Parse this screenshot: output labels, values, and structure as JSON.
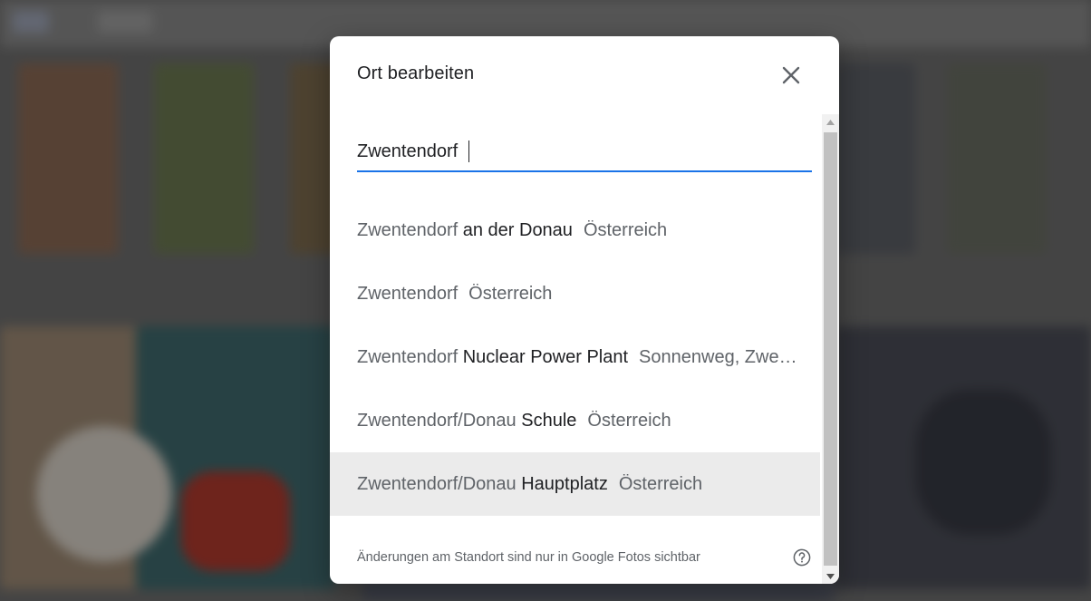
{
  "dialog": {
    "title": "Ort bearbeiten",
    "close_icon": "close-icon"
  },
  "search": {
    "value": "Zwentendorf",
    "placeholder": ""
  },
  "results": [
    {
      "match": "Zwentendorf",
      "rest": " an der Donau",
      "secondary": "Österreich",
      "highlighted": false
    },
    {
      "match": "Zwentendorf",
      "rest": "",
      "secondary": "Österreich",
      "highlighted": false
    },
    {
      "match": "Zwentendorf",
      "rest": " Nuclear Power Plant",
      "secondary": "Sonnenweg, Zwent…",
      "highlighted": false
    },
    {
      "match": "Zwentendorf/Donau",
      "rest": " Schule",
      "secondary": "Österreich",
      "highlighted": false
    },
    {
      "match": "Zwentendorf/Donau",
      "rest": " Hauptplatz",
      "secondary": "Österreich",
      "highlighted": true
    }
  ],
  "footer": {
    "note": "Änderungen am Standort sind nur in Google Fotos sichtbar",
    "help_icon": "help-circle-icon"
  },
  "colors": {
    "accent": "#1a73e8",
    "highlight": "#ebebeb",
    "primary_text": "#202124",
    "secondary_text": "#5f6368"
  },
  "scrollbar": {
    "up_icon": "scroll-up-arrow-icon",
    "down_icon": "scroll-down-arrow-icon"
  }
}
